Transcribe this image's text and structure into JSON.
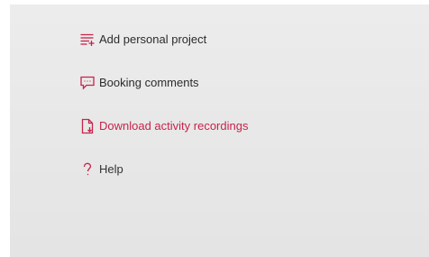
{
  "colors": {
    "accent": "#c8234a",
    "text": "#2b2b2b",
    "panel_bg": "#e8e8e8"
  },
  "menu": {
    "items": [
      {
        "id": "add-personal-project",
        "label": "Add personal project",
        "icon": "list-add-icon"
      },
      {
        "id": "booking-comments",
        "label": "Booking comments",
        "icon": "comment-icon"
      },
      {
        "id": "download-activity-recordings",
        "label": "Download activity recordings",
        "icon": "file-download-icon"
      },
      {
        "id": "help",
        "label": "Help",
        "icon": "question-mark-icon"
      }
    ]
  }
}
